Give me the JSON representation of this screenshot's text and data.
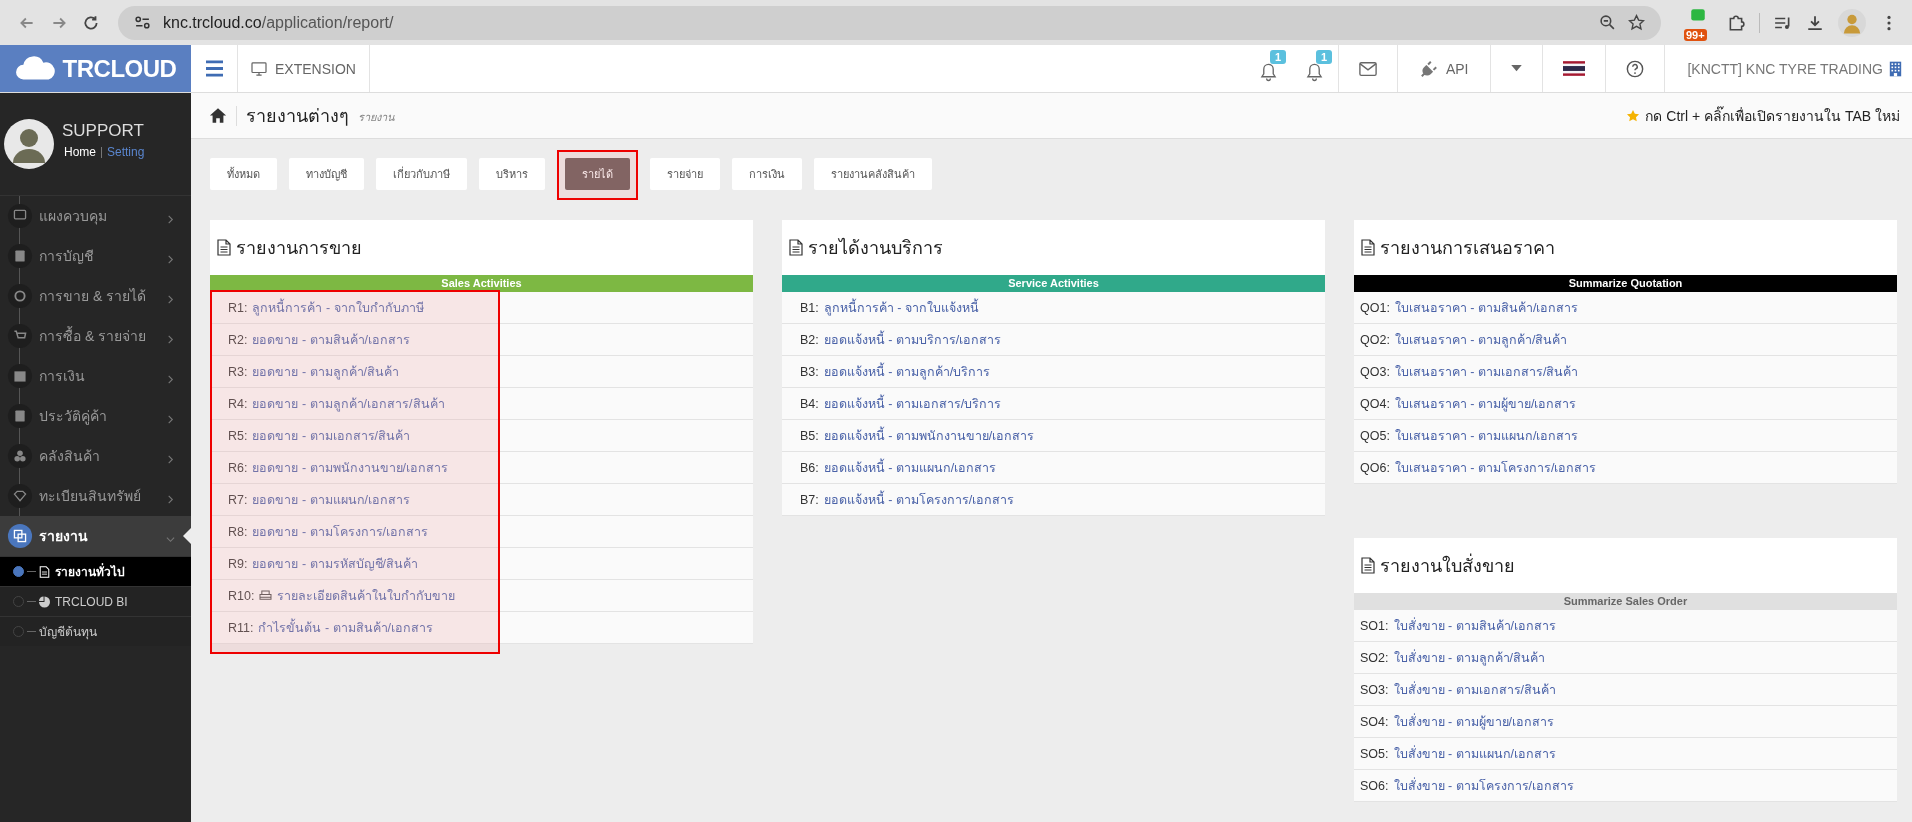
{
  "browser": {
    "url_host": "knc.trcloud.co",
    "url_path": "/application/report/",
    "extension_badge": "99+"
  },
  "header": {
    "logo": "TRCLOUD",
    "extension": "EXTENSION",
    "notifications": [
      {
        "count": "1"
      },
      {
        "count": "1"
      }
    ],
    "api": "API",
    "company": "[KNCTT] KNC TYRE TRADING"
  },
  "profile": {
    "name": "SUPPORT",
    "links": [
      "Home",
      "Setting"
    ]
  },
  "sidebar": {
    "items": [
      {
        "label": "แผงควบคุม",
        "selected": false,
        "expanded": false
      },
      {
        "label": "การบัญชี",
        "selected": false,
        "expanded": false
      },
      {
        "label": "การขาย & รายได้",
        "selected": false,
        "expanded": false
      },
      {
        "label": "การซื้อ & รายจ่าย",
        "selected": false,
        "expanded": false
      },
      {
        "label": "การเงิน",
        "selected": false,
        "expanded": false
      },
      {
        "label": "ประวัติคู่ค้า",
        "selected": false,
        "expanded": false
      },
      {
        "label": "คลังสินค้า",
        "selected": false,
        "expanded": false
      },
      {
        "label": "ทะเบียนสินทรัพย์",
        "selected": false,
        "expanded": false
      },
      {
        "label": "รายงาน",
        "selected": true,
        "expanded": true,
        "children": [
          {
            "label": "รายงานทั่วไป",
            "selected": true
          },
          {
            "label": "TRCLOUD BI",
            "selected": false
          },
          {
            "label": "บัญชีต้นทุน",
            "selected": false
          }
        ]
      }
    ]
  },
  "breadcrumb": {
    "title": "รายงานต่างๆ",
    "subtitle": "รายงาน",
    "hint": "กด Ctrl + คลิ๊กเพื่อเปิดรายงานใน TAB ใหม่"
  },
  "tabs": [
    {
      "label": "ทั้งหมด",
      "selected": false,
      "highlighted": false
    },
    {
      "label": "ทางบัญชี",
      "selected": false,
      "highlighted": false
    },
    {
      "label": "เกี่ยวกับภาษี",
      "selected": false,
      "highlighted": false
    },
    {
      "label": "บริหาร",
      "selected": false,
      "highlighted": false
    },
    {
      "label": "รายได้",
      "selected": true,
      "highlighted": true
    },
    {
      "label": "รายจ่าย",
      "selected": false,
      "highlighted": false
    },
    {
      "label": "การเงิน",
      "selected": false,
      "highlighted": false
    },
    {
      "label": "รายงานคลังสินค้า",
      "selected": false,
      "highlighted": false
    }
  ],
  "columns": [
    {
      "panels": [
        {
          "title": "รายงานการขาย",
          "banner": "Sales Activities",
          "color": "#7db843",
          "highlighted": true,
          "rows": [
            {
              "code": "R1:",
              "label": "ลูกหนี้การค้า - จากใบกำกับภาษี",
              "kind": "link"
            },
            {
              "code": "R2:",
              "label": "ยอดขาย - ตามสินค้า/เอกสาร",
              "kind": "link"
            },
            {
              "code": "R3:",
              "label": "ยอดขาย - ตามลูกค้า/สินค้า",
              "kind": "link"
            },
            {
              "code": "R4:",
              "label": "ยอดขาย - ตามลูกค้า/เอกสาร/สินค้า",
              "kind": "link"
            },
            {
              "code": "R5:",
              "label": "ยอดขาย - ตามเอกสาร/สินค้า",
              "kind": "link"
            },
            {
              "code": "R6:",
              "label": "ยอดขาย - ตามพนักงานขาย/เอกสาร",
              "kind": "link"
            },
            {
              "code": "R7:",
              "label": "ยอดขาย - ตามแผนก/เอกสาร",
              "kind": "link"
            },
            {
              "code": "R8:",
              "label": "ยอดขาย - ตามโครงการ/เอกสาร",
              "kind": "link"
            },
            {
              "code": "R9:",
              "label": "ยอดขาย - ตามรหัสบัญชี/สินค้า",
              "kind": "link"
            },
            {
              "code": "R10:",
              "label": "รายละเอียดสินค้าในใบกำกับขาย",
              "kind": "print"
            },
            {
              "code": "R11:",
              "label": "กำไรขั้นต้น - ตามสินค้า/เอกสาร",
              "kind": "link"
            }
          ]
        }
      ]
    },
    {
      "panels": [
        {
          "title": "รายได้งานบริการ",
          "banner": "Service Activities",
          "color": "#30a98a",
          "highlighted": false,
          "rows": [
            {
              "code": "B1:",
              "label": "ลูกหนี้การค้า - จากใบแจ้งหนี้",
              "kind": "link"
            },
            {
              "code": "B2:",
              "label": "ยอดแจ้งหนี้ - ตามบริการ/เอกสาร",
              "kind": "link"
            },
            {
              "code": "B3:",
              "label": "ยอดแจ้งหนี้ - ตามลูกค้า/บริการ",
              "kind": "link"
            },
            {
              "code": "B4:",
              "label": "ยอดแจ้งหนี้ - ตามเอกสาร/บริการ",
              "kind": "link"
            },
            {
              "code": "B5:",
              "label": "ยอดแจ้งหนี้ - ตามพนักงานขาย/เอกสาร",
              "kind": "link"
            },
            {
              "code": "B6:",
              "label": "ยอดแจ้งหนี้ - ตามแผนก/เอกสาร",
              "kind": "link"
            },
            {
              "code": "B7:",
              "label": "ยอดแจ้งหนี้ - ตามโครงการ/เอกสาร",
              "kind": "link"
            }
          ]
        }
      ]
    },
    {
      "panels": [
        {
          "title": "รายงานการเสนอราคา",
          "banner": "Summarize Quotation",
          "color": "#000000",
          "highlighted": false,
          "rows": [
            {
              "code": "QO1:",
              "label": "ใบเสนอราคา - ตามสินค้า/เอกสาร",
              "kind": "link"
            },
            {
              "code": "QO2:",
              "label": "ใบเสนอราคา - ตามลูกค้า/สินค้า",
              "kind": "link"
            },
            {
              "code": "QO3:",
              "label": "ใบเสนอราคา - ตามเอกสาร/สินค้า",
              "kind": "link"
            },
            {
              "code": "QO4:",
              "label": "ใบเสนอราคา - ตามผู้ขาย/เอกสาร",
              "kind": "link"
            },
            {
              "code": "QO5:",
              "label": "ใบเสนอราคา - ตามแผนก/เอกสาร",
              "kind": "link"
            },
            {
              "code": "QO6:",
              "label": "ใบเสนอราคา - ตามโครงการ/เอกสาร",
              "kind": "link"
            }
          ]
        },
        {
          "title": "รายงานใบสั่งขาย",
          "banner": "Summarize Sales Order",
          "color": "#e0e0e0",
          "highlighted": false,
          "rows": [
            {
              "code": "SO1:",
              "label": "ใบสั่งขาย - ตามสินค้า/เอกสาร",
              "kind": "link"
            },
            {
              "code": "SO2:",
              "label": "ใบสั่งขาย - ตามลูกค้า/สินค้า",
              "kind": "link"
            },
            {
              "code": "SO3:",
              "label": "ใบสั่งขาย - ตามเอกสาร/สินค้า",
              "kind": "link"
            },
            {
              "code": "SO4:",
              "label": "ใบสั่งขาย - ตามผู้ขาย/เอกสาร",
              "kind": "link"
            },
            {
              "code": "SO5:",
              "label": "ใบสั่งขาย - ตามแผนก/เอกสาร",
              "kind": "link"
            },
            {
              "code": "SO6:",
              "label": "ใบสั่งขาย - ตามโครงการ/เอกสาร",
              "kind": "link"
            }
          ]
        }
      ]
    }
  ]
}
